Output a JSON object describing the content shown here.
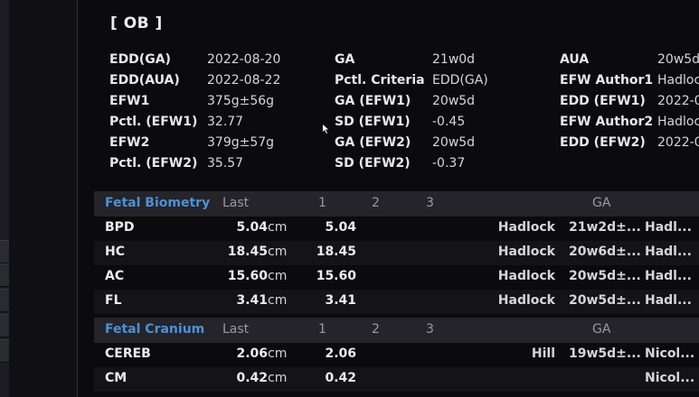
{
  "panel": {
    "title": "[ OB ]"
  },
  "summary": [
    [
      "EDD(GA)",
      "2022-08-20",
      "GA",
      "21w0d",
      "AUA",
      "20w5d"
    ],
    [
      "EDD(AUA)",
      "2022-08-22",
      "Pctl. Criteria",
      "EDD(GA)",
      "EFW Author1",
      "Hadlock"
    ],
    [
      "EFW1",
      "375g±56g",
      "GA (EFW1)",
      "20w5d",
      "EDD (EFW1)",
      "2022-0"
    ],
    [
      "Pctl. (EFW1)",
      "32.77",
      "SD (EFW1)",
      "-0.45",
      "EFW Author2",
      "Hadlock"
    ],
    [
      "EFW2",
      "379g±57g",
      "GA (EFW2)",
      "20w5d",
      "EDD (EFW2)",
      "2022-0"
    ],
    [
      "Pctl. (EFW2)",
      "35.57",
      "SD (EFW2)",
      "-0.37",
      "",
      ""
    ]
  ],
  "biometry": {
    "title": "Fetal Biometry",
    "headers": {
      "last": "Last",
      "c1": "1",
      "c2": "2",
      "c3": "3",
      "ga": "GA"
    },
    "rows": [
      {
        "name": "BPD",
        "last": "5.04",
        "unit": "cm",
        "v1": "5.04",
        "author": "Hadlock",
        "ga": "21w2d±...",
        "ga2": "Hadl..."
      },
      {
        "name": "HC",
        "last": "18.45",
        "unit": "cm",
        "v1": "18.45",
        "author": "Hadlock",
        "ga": "20w6d±...",
        "ga2": "Hadl..."
      },
      {
        "name": "AC",
        "last": "15.60",
        "unit": "cm",
        "v1": "15.60",
        "author": "Hadlock",
        "ga": "20w5d±...",
        "ga2": "Hadl..."
      },
      {
        "name": "FL",
        "last": "3.41",
        "unit": "cm",
        "v1": "3.41",
        "author": "Hadlock",
        "ga": "20w5d±...",
        "ga2": "Hadl..."
      }
    ]
  },
  "cranium": {
    "title": "Fetal Cranium",
    "headers": {
      "last": "Last",
      "c1": "1",
      "c2": "2",
      "c3": "3",
      "ga": "GA"
    },
    "rows": [
      {
        "name": "CEREB",
        "last": "2.06",
        "unit": "cm",
        "v1": "2.06",
        "author": "Hill",
        "ga": "19w5d±...",
        "ga2": "Nicol..."
      },
      {
        "name": "CM",
        "last": "0.42",
        "unit": "cm",
        "v1": "0.42",
        "author": "",
        "ga": "",
        "ga2": "Nicol..."
      }
    ]
  },
  "icons": {
    "cursor": "mouse-pointer-icon"
  }
}
